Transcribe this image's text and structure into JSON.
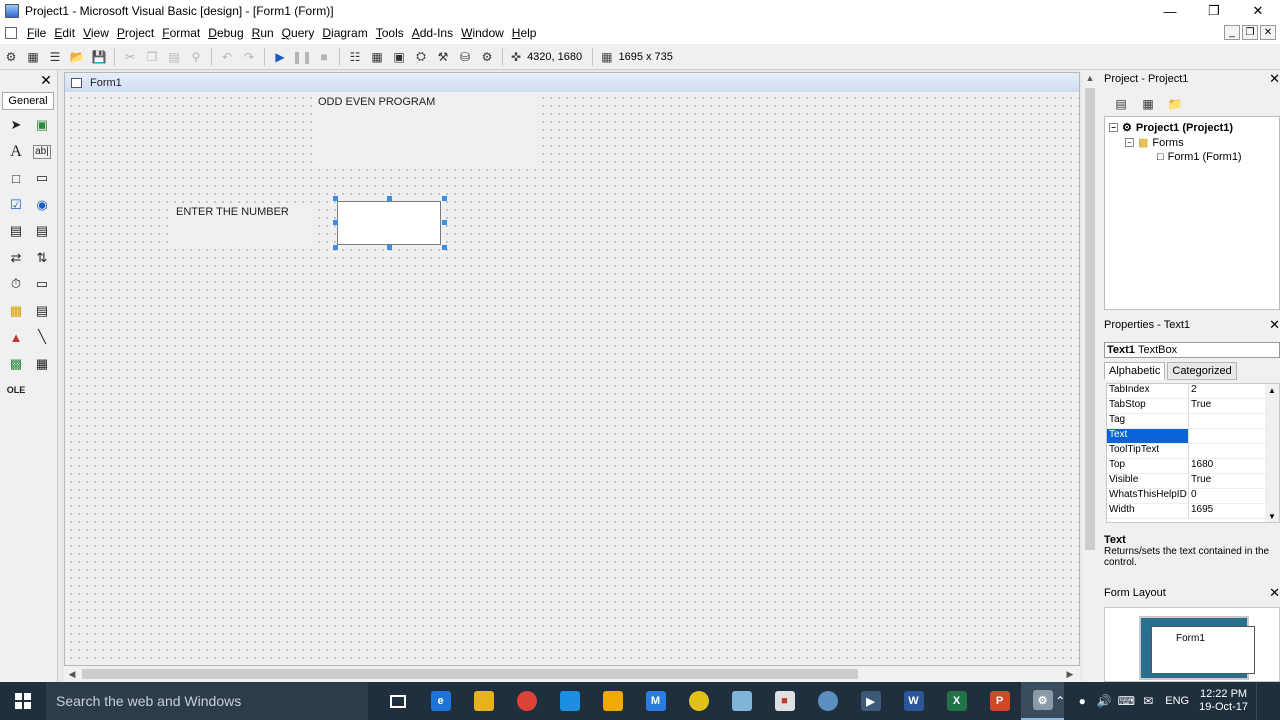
{
  "window": {
    "title": "Project1 - Microsoft Visual Basic [design] - [Form1 (Form)]"
  },
  "menu": [
    "File",
    "Edit",
    "View",
    "Project",
    "Format",
    "Debug",
    "Run",
    "Query",
    "Diagram",
    "Tools",
    "Add-Ins",
    "Window",
    "Help"
  ],
  "toolbar": {
    "position": "4320, 1680",
    "size": "1695 x 735"
  },
  "toolbox": {
    "tab": "General"
  },
  "form": {
    "title": "Form1",
    "label_heading": "ODD EVEN PROGRAM",
    "label_prompt": "ENTER THE NUMBER",
    "textbox_value": ""
  },
  "project": {
    "title": "Project - Project1",
    "root": "Project1 (Project1)",
    "folder": "Forms",
    "item": "Form1 (Form1)"
  },
  "properties": {
    "title": "Properties - Text1",
    "object_name": "Text1",
    "object_type": "TextBox",
    "tabs": [
      "Alphabetic",
      "Categorized"
    ],
    "rows": [
      {
        "name": "TabIndex",
        "value": "2"
      },
      {
        "name": "TabStop",
        "value": "True"
      },
      {
        "name": "Tag",
        "value": ""
      },
      {
        "name": "Text",
        "value": ""
      },
      {
        "name": "ToolTipText",
        "value": ""
      },
      {
        "name": "Top",
        "value": "1680"
      },
      {
        "name": "Visible",
        "value": "True"
      },
      {
        "name": "WhatsThisHelpID",
        "value": "0"
      },
      {
        "name": "Width",
        "value": "1695"
      }
    ],
    "selected_row": "Text",
    "desc_title": "Text",
    "desc_text": "Returns/sets the text contained in the control."
  },
  "form_layout": {
    "title": "Form Layout",
    "preview_label": "Form1"
  },
  "taskbar": {
    "search_placeholder": "Search the web and Windows",
    "language": "ENG",
    "time": "12:22 PM",
    "date": "19-Oct-17"
  },
  "colors": {
    "selection": "#0a64d8",
    "handle": "#3a8ee6",
    "taskbar": "#1f2f3e"
  }
}
